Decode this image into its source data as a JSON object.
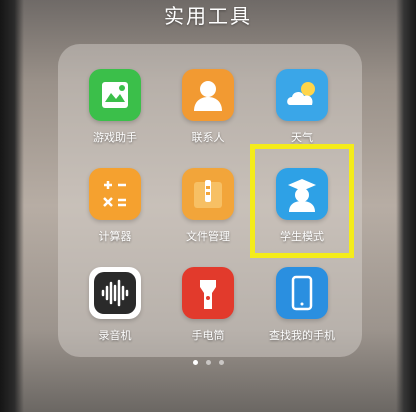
{
  "folder": {
    "title": "实用工具"
  },
  "apps": [
    {
      "label": "游戏助手",
      "icon": "game-assistant-icon",
      "color": "#3bbf4a"
    },
    {
      "label": "联系人",
      "icon": "contacts-icon",
      "color": "#f29a32"
    },
    {
      "label": "天气",
      "icon": "weather-icon",
      "color": "#3aa6e8"
    },
    {
      "label": "计算器",
      "icon": "calculator-icon",
      "color": "#f5a12f"
    },
    {
      "label": "文件管理",
      "icon": "file-manager-icon",
      "color": "#f2a53a"
    },
    {
      "label": "学生模式",
      "icon": "student-mode-icon",
      "color": "#2ea1e6"
    },
    {
      "label": "录音机",
      "icon": "recorder-icon",
      "color": "#2a2a2a"
    },
    {
      "label": "手电筒",
      "icon": "flashlight-icon",
      "color": "#e23a2c"
    },
    {
      "label": "查找我的手机",
      "icon": "find-my-phone-icon",
      "color": "#2a8fe0"
    }
  ],
  "pagination": {
    "pages": 3,
    "current": 1
  },
  "highlight": {
    "target": "学生模式",
    "color": "#f4ec1a"
  }
}
